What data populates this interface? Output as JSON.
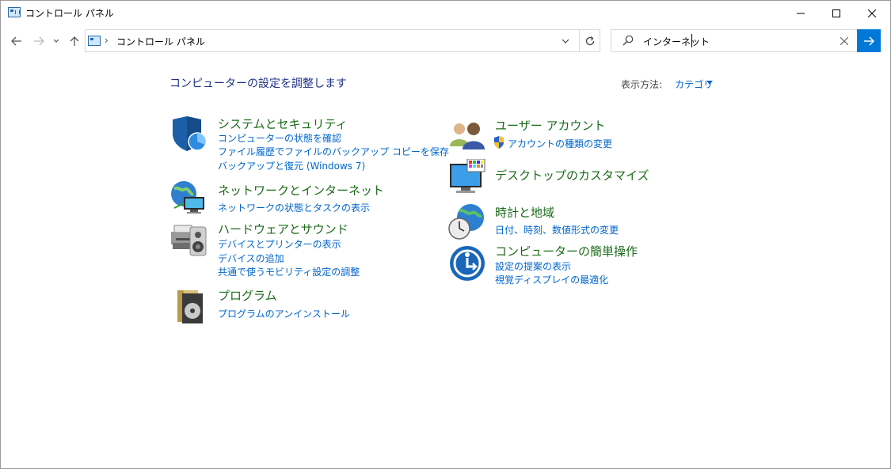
{
  "window": {
    "title": "コントロール パネル",
    "controls": {
      "minimize": "minimize",
      "maximize": "maximize",
      "close": "close"
    }
  },
  "address": {
    "crumb": "コントロール パネル"
  },
  "search": {
    "value": "インターネット"
  },
  "header": {
    "title": "コンピューターの設定を調整します",
    "view_by_label": "表示方法:",
    "view_by_value": "カテゴリ"
  },
  "categories_left": [
    {
      "title": "システムとセキュリティ",
      "icon": "shield-icon",
      "links": [
        "コンピューターの状態を確認",
        "ファイル履歴でファイルのバックアップ コピーを保存",
        "バックアップと復元 (Windows 7)"
      ]
    },
    {
      "title": "ネットワークとインターネット",
      "icon": "network-globe-icon",
      "links": [
        "ネットワークの状態とタスクの表示"
      ]
    },
    {
      "title": "ハードウェアとサウンド",
      "icon": "printer-speaker-icon",
      "links": [
        "デバイスとプリンターの表示",
        "デバイスの追加",
        "共通で使うモビリティ設定の調整"
      ]
    },
    {
      "title": "プログラム",
      "icon": "program-disc-icon",
      "links": [
        "プログラムのアンインストール"
      ]
    }
  ],
  "categories_right": [
    {
      "title": "ユーザー アカウント",
      "icon": "users-icon",
      "links": [
        "アカウントの種類の変更"
      ]
    },
    {
      "title": "デスクトップのカスタマイズ",
      "icon": "desktop-monitor-icon",
      "links": []
    },
    {
      "title": "時計と地域",
      "icon": "clock-globe-icon",
      "links": [
        "日付、時刻、数値形式の変更"
      ]
    },
    {
      "title": "コンピューターの簡単操作",
      "icon": "ease-of-access-icon",
      "links": [
        "設定の提案の表示",
        "視覚ディスプレイの最適化"
      ]
    }
  ],
  "colors": {
    "accent": "#0078d7",
    "link": "#0066cc",
    "category_title": "#1a6b1a",
    "page_title": "#1e3287"
  }
}
